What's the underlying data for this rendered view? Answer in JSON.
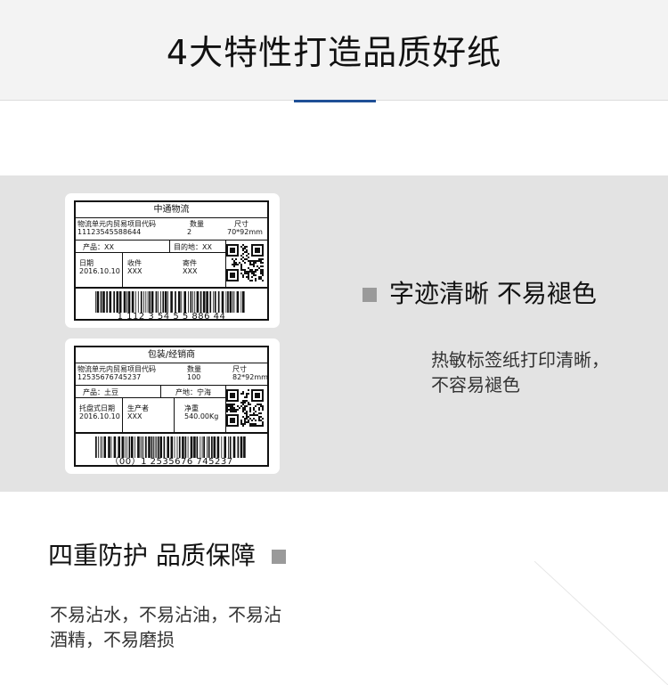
{
  "header": {
    "title": "4大特性打造品质好纸"
  },
  "labels": [
    {
      "title": "中通物流",
      "code_label": "物流单元内贸易项目代码",
      "code_value": "11123545588644",
      "qty_label": "数量",
      "qty_value": "2",
      "size_label": "尺寸",
      "size_value": "70*92mm",
      "field_a": "产品：XX",
      "field_b": "目的地：XX",
      "date_label": "日期",
      "date_value": "2016.10.10",
      "p2_label": "收件",
      "p2_value": "XXX",
      "p3_label": "寄件",
      "p3_value": "XXX",
      "barcode_text": "1  112  3 54   5 5   886 44"
    },
    {
      "title": "包装/经销商",
      "code_label": "物流单元内贸易项目代码",
      "code_value": "12535676745237",
      "qty_label": "数量",
      "qty_value": "100",
      "size_label": "尺寸",
      "size_value": "82*92mm",
      "field_a": "产品：土豆",
      "field_b": "产地：宁海",
      "date_label": "托盘式日期",
      "date_value": "2016.10.10",
      "p2_label": "生产者",
      "p2_value": "XXX",
      "p3_label": "净重",
      "p3_value": "540.00Kg",
      "barcode_text": "（00）1 2535676 745237"
    }
  ],
  "feature1": {
    "title": "字迹清晰  不易褪色",
    "desc_line1": "热敏标签纸打印清晰，",
    "desc_line2": "不容易褪色"
  },
  "feature2": {
    "title": "四重防护  品质保障",
    "desc_line1": "不易沾水，不易沾油，不易沾",
    "desc_line2": "酒精，不易磨损"
  },
  "colors": {
    "accent": "#1f4f96",
    "band": "#e3e3e3",
    "square": "#9a9a9a"
  }
}
